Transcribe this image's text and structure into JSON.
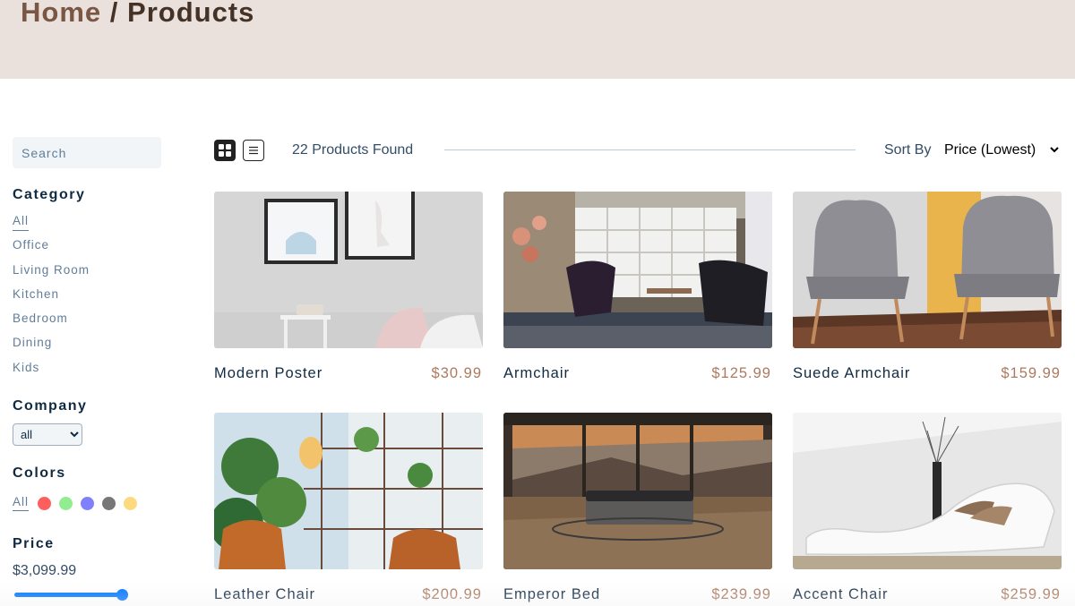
{
  "hero": {
    "home": "Home",
    "separator": "/",
    "current": "Products"
  },
  "filters": {
    "search_placeholder": "Search",
    "category_title": "Category",
    "categories": [
      "All",
      "Office",
      "Living Room",
      "Kitchen",
      "Bedroom",
      "Dining",
      "Kids"
    ],
    "active_category": "All",
    "company_title": "Company",
    "company_selected": "all",
    "colors_title": "Colors",
    "colors_all_label": "All",
    "colors": [
      "#ff5e5e",
      "#90ee90",
      "#8080ff",
      "#777777",
      "#ffd980"
    ],
    "price_title": "Price",
    "price_value": "$3,099.99",
    "price_slider_fraction": 1.0
  },
  "toolbar": {
    "grid_icon": "grid-view-icon",
    "list_icon": "list-view-icon",
    "products_found": "22 Products Found",
    "sort_label": "Sort By",
    "sort_selected": "Price (Lowest)"
  },
  "products": [
    {
      "name": "Modern Poster",
      "price": "$30.99"
    },
    {
      "name": "Armchair",
      "price": "$125.99"
    },
    {
      "name": "Suede Armchair",
      "price": "$159.99"
    },
    {
      "name": "Leather Chair",
      "price": "$200.99"
    },
    {
      "name": "Emperor Bed",
      "price": "$239.99"
    },
    {
      "name": "Accent Chair",
      "price": "$259.99"
    }
  ],
  "theme": {
    "accent": "#ab7a5f",
    "hero_bg": "#eae0dc",
    "slider": "#0075ff"
  }
}
